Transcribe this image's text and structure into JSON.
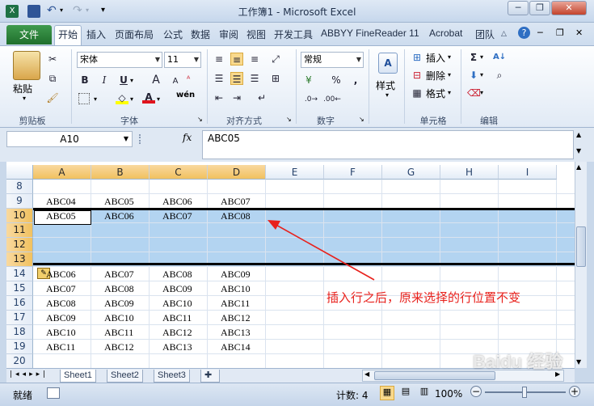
{
  "window": {
    "title": "工作簿1 - Microsoft Excel",
    "min": "─",
    "restore": "❐",
    "close": "✕"
  },
  "qat": {
    "icon_app": "excel-icon",
    "save": "save-icon",
    "undo": "undo-icon",
    "redo": "redo-icon"
  },
  "tabs": {
    "file": "文件",
    "home": "开始",
    "insert": "插入",
    "layout": "页面布局",
    "formulas": "公式",
    "data": "数据",
    "review": "审阅",
    "view": "视图",
    "dev": "开发工具",
    "abbyy": "ABBYY FineReader 11",
    "acrobat": "Acrobat",
    "team": "团队"
  },
  "ribbon": {
    "clipboard": {
      "paste": "粘贴",
      "label": "剪贴板"
    },
    "font": {
      "name": "宋体",
      "size": "11",
      "bold": "B",
      "italic": "I",
      "underline": "U",
      "grow": "A",
      "shrink": "A",
      "wen": "wén",
      "label": "字体"
    },
    "align": {
      "label": "对齐方式"
    },
    "number": {
      "format": "常规",
      "percent": "%",
      "comma": ",",
      "label": "数字"
    },
    "styles": {
      "btn": "样式"
    },
    "cells": {
      "insert": "插入",
      "delete": "删除",
      "format": "格式",
      "label": "单元格"
    },
    "editing": {
      "sigma": "Σ",
      "label": "编辑"
    }
  },
  "formula_bar": {
    "name_box": "A10",
    "fx": "fx",
    "content": "ABC05"
  },
  "grid": {
    "columns": [
      "A",
      "B",
      "C",
      "D",
      "E",
      "F",
      "G",
      "H",
      "I"
    ],
    "rows": [
      {
        "num": "8",
        "cells": [
          "",
          "",
          "",
          ""
        ]
      },
      {
        "num": "9",
        "cells": [
          "ABC04",
          "ABC05",
          "ABC06",
          "ABC07"
        ]
      },
      {
        "num": "10",
        "cells": [
          "ABC05",
          "ABC06",
          "ABC07",
          "ABC08"
        ]
      },
      {
        "num": "11",
        "cells": [
          "",
          "",
          "",
          ""
        ]
      },
      {
        "num": "12",
        "cells": [
          "",
          "",
          "",
          ""
        ]
      },
      {
        "num": "13",
        "cells": [
          "",
          "",
          "",
          ""
        ]
      },
      {
        "num": "14",
        "cells": [
          "ABC06",
          "ABC07",
          "ABC08",
          "ABC09"
        ]
      },
      {
        "num": "15",
        "cells": [
          "ABC07",
          "ABC08",
          "ABC09",
          "ABC10"
        ]
      },
      {
        "num": "16",
        "cells": [
          "ABC08",
          "ABC09",
          "ABC10",
          "ABC11"
        ]
      },
      {
        "num": "17",
        "cells": [
          "ABC09",
          "ABC10",
          "ABC11",
          "ABC12"
        ]
      },
      {
        "num": "18",
        "cells": [
          "ABC10",
          "ABC11",
          "ABC12",
          "ABC13"
        ]
      },
      {
        "num": "19",
        "cells": [
          "ABC11",
          "ABC12",
          "ABC13",
          "ABC14"
        ]
      },
      {
        "num": "20",
        "cells": [
          "",
          "",
          "",
          ""
        ]
      }
    ]
  },
  "annotation": {
    "text": "插入行之后，原来选择的行位置不变",
    "color": "#e8211c"
  },
  "sheets": [
    "Sheet1",
    "Sheet2",
    "Sheet3"
  ],
  "status": {
    "ready": "就绪",
    "count": "计数: 4",
    "zoom": "100%",
    "minus": "−",
    "plus": "+"
  },
  "watermark": "Baidu 经验"
}
